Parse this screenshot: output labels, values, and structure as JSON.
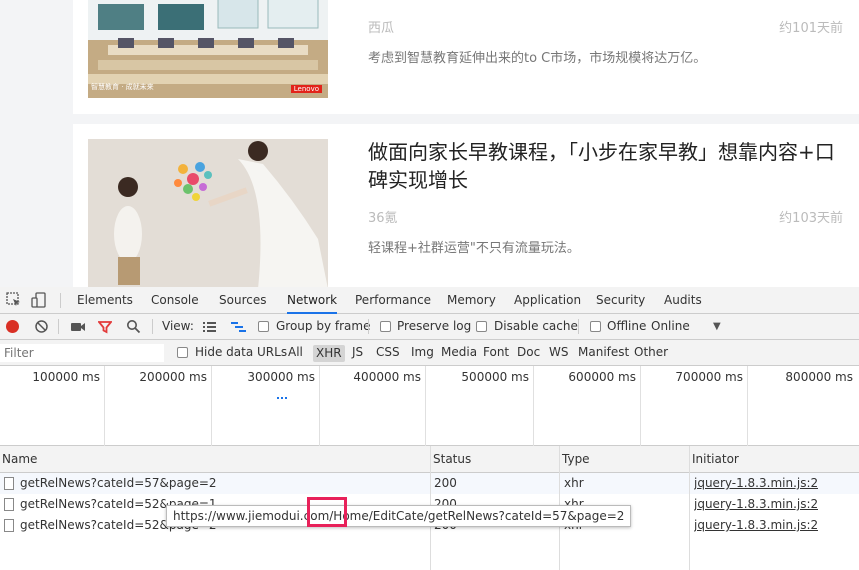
{
  "web": {
    "articles": [
      {
        "title": "",
        "source": "西瓜",
        "time": "约101天前",
        "desc": "考虑到智慧教育延伸出来的to C市场，市场规模将达万亿。",
        "thumb_caption_left": "智慧教育 · 成就未来",
        "thumb_caption_right": "Lenovo"
      },
      {
        "title": "做面向家长早教课程，「小步在家早教」想靠内容+口碑实现增长",
        "source": "36氪",
        "time": "约103天前",
        "desc": "轻课程+社群运营\"不只有流量玩法。"
      }
    ]
  },
  "devtools": {
    "tabs": [
      "Elements",
      "Console",
      "Sources",
      "Network",
      "Performance",
      "Memory",
      "Application",
      "Security",
      "Audits"
    ],
    "active_tab": "Network",
    "toolbar": {
      "view_label": "View:",
      "group_by_frame": "Group by frame",
      "preserve_log": "Preserve log",
      "disable_cache": "Disable cache",
      "offline": "Offline",
      "throttle": "Online"
    },
    "filter": {
      "placeholder": "Filter",
      "hide_data_urls": "Hide data URLs",
      "types": [
        "All",
        "XHR",
        "JS",
        "CSS",
        "Img",
        "Media",
        "Font",
        "Doc",
        "WS",
        "Manifest",
        "Other"
      ],
      "selected_type": "XHR"
    },
    "timeline": [
      "100000 ms",
      "200000 ms",
      "300000 ms",
      "400000 ms",
      "500000 ms",
      "600000 ms",
      "700000 ms",
      "800000 ms"
    ],
    "table": {
      "headers": [
        "Name",
        "Status",
        "Type",
        "Initiator"
      ],
      "rows": [
        {
          "name": "getRelNews?cateId=57&page=2",
          "status": "200",
          "type": "xhr",
          "initiator": "jquery-1.8.3.min.js:2"
        },
        {
          "name": "getRelNews?cateId=52&page=1",
          "status": "200",
          "type": "xhr",
          "initiator": "jquery-1.8.3.min.js:2"
        },
        {
          "name": "getRelNews?cateId=52&page=2",
          "status": "200",
          "type": "xhr",
          "initiator": "jquery-1.8.3.min.js:2"
        }
      ]
    },
    "tooltip": {
      "pre": "https://www.jiemodui.com/",
      "highlight": "Home",
      "post": "/EditCate/getRelNews?cateId=57&page=2"
    }
  },
  "colors": {
    "accent": "#1a73e8",
    "record_red": "#d93025",
    "highlight_box": "#e8215a",
    "filter_funnel": "#e33a3a"
  }
}
